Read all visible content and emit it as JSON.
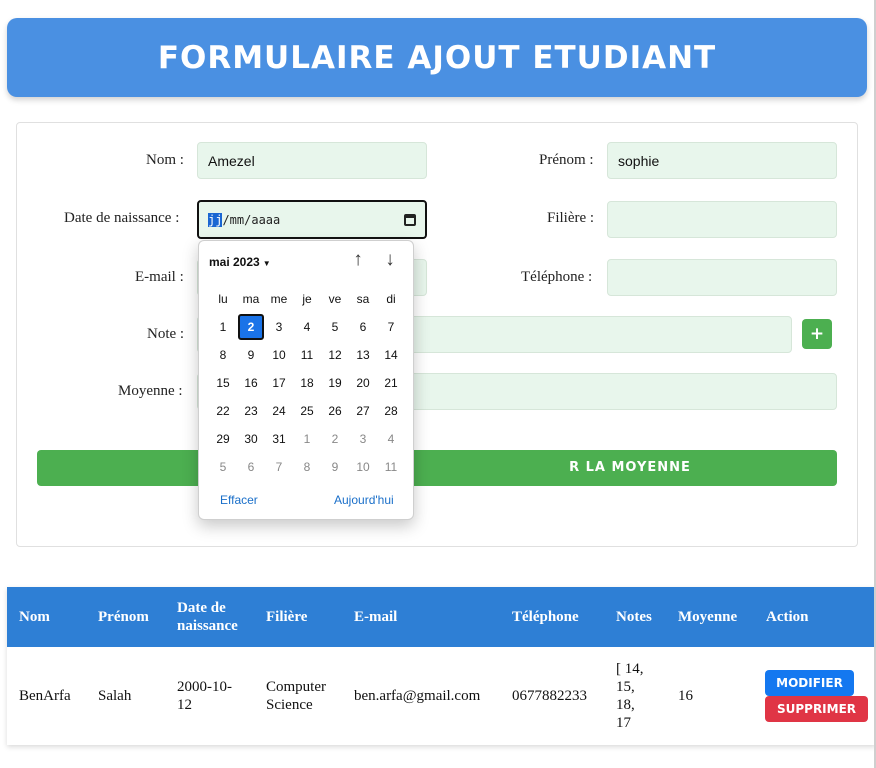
{
  "header": {
    "title": "FORMULAIRE AJOUT ETUDIANT"
  },
  "form": {
    "nom_label": "Nom :",
    "nom_value": "Amezel",
    "prenom_label": "Prénom :",
    "prenom_value": "sophie",
    "date_label": "Date de naissance :",
    "date_day_placeholder": "jj",
    "date_rest_placeholder": "/mm/aaaa",
    "filiere_label": "Filière :",
    "filiere_value": "",
    "email_label": "E-mail :",
    "email_value": "",
    "telephone_label": "Téléphone :",
    "telephone_value": "",
    "note_label": "Note :",
    "note_value": "",
    "add_note_label": "+",
    "moyenne_label": "Moyenne :",
    "moyenne_value": "",
    "calc_button_visible_text": "R LA MOYENNE"
  },
  "datepicker": {
    "month_label": "mai 2023",
    "weekdays": [
      "lu",
      "ma",
      "me",
      "je",
      "ve",
      "sa",
      "di"
    ],
    "weeks": [
      [
        "1",
        "2",
        "3",
        "4",
        "5",
        "6",
        "7"
      ],
      [
        "8",
        "9",
        "10",
        "11",
        "12",
        "13",
        "14"
      ],
      [
        "15",
        "16",
        "17",
        "18",
        "19",
        "20",
        "21"
      ],
      [
        "22",
        "23",
        "24",
        "25",
        "26",
        "27",
        "28"
      ],
      [
        "29",
        "30",
        "31",
        "1",
        "2",
        "3",
        "4"
      ],
      [
        "5",
        "6",
        "7",
        "8",
        "9",
        "10",
        "11"
      ]
    ],
    "clear_label": "Effacer",
    "today_label": "Aujourd'hui"
  },
  "table": {
    "headers": {
      "nom": "Nom",
      "prenom": "Prénom",
      "date_line1": "Date de",
      "date_line2": "naissance",
      "filiere": "Filière",
      "email": "E-mail",
      "telephone": "Téléphone",
      "notes": "Notes",
      "moyenne": "Moyenne",
      "action": "Action"
    },
    "row": {
      "nom": "BenArfa",
      "prenom": "Salah",
      "date_line1": "2000-10-",
      "date_line2": "12",
      "filiere_line1": "Computer",
      "filiere_line2": "Science",
      "email": "ben.arfa@gmail.com",
      "telephone": "0677882233",
      "notes_lines": [
        "[ 14,",
        "15,",
        "18,",
        "17"
      ],
      "moyenne": "16",
      "modifier_label": "MODIFIER",
      "supprimer_label": "SUPPRIMER"
    }
  },
  "colors": {
    "header_bg": "#4a90e2",
    "input_bg": "#e8f6ec",
    "green_button": "#4caf50",
    "table_header_bg": "#2e7fd5",
    "modify_button": "#1478f0",
    "delete_button": "#e03545"
  }
}
